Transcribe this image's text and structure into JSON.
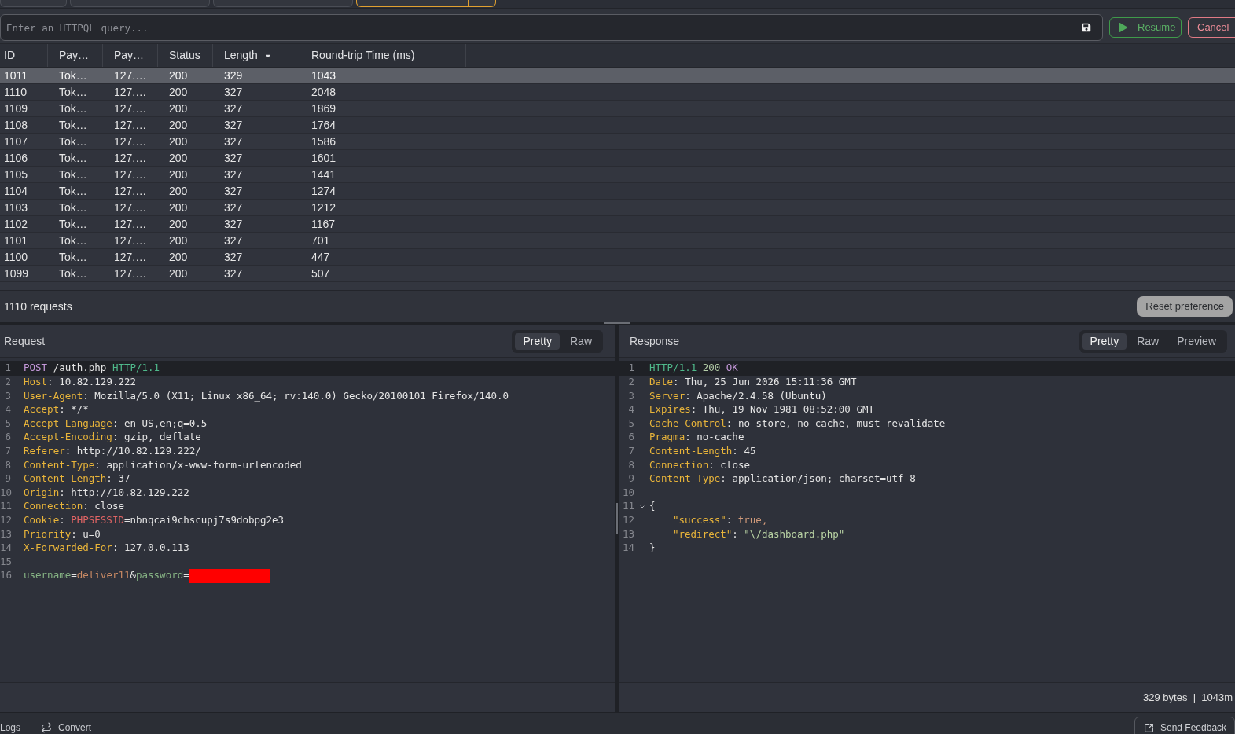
{
  "tabs": [
    {
      "selected": false
    },
    {
      "selected": false
    },
    {
      "selected": false
    },
    {
      "selected": true
    }
  ],
  "query": {
    "placeholder": "Enter an HTTPQL query..."
  },
  "buttons": [
    {
      "label": "Resume",
      "kind": "resume"
    },
    {
      "label": "Cancel",
      "kind": "cancel"
    }
  ],
  "table": {
    "columns": [
      {
        "label": "ID",
        "sorted": false
      },
      {
        "label": "Pay…",
        "sorted": false
      },
      {
        "label": "Pay…",
        "sorted": false
      },
      {
        "label": "Status",
        "sorted": false
      },
      {
        "label": "Length",
        "sorted": true
      },
      {
        "label": "Round-trip Time (ms)",
        "sorted": false
      }
    ],
    "rows": [
      {
        "cells": [
          "1011",
          "Tok…",
          "127.…",
          "200",
          "329",
          "1043"
        ],
        "selected": true
      },
      {
        "cells": [
          "1110",
          "Tok…",
          "127.…",
          "200",
          "327",
          "2048"
        ],
        "selected": false
      },
      {
        "cells": [
          "1109",
          "Tok…",
          "127.…",
          "200",
          "327",
          "1869"
        ],
        "selected": false
      },
      {
        "cells": [
          "1108",
          "Tok…",
          "127.…",
          "200",
          "327",
          "1764"
        ],
        "selected": false
      },
      {
        "cells": [
          "1107",
          "Tok…",
          "127.…",
          "200",
          "327",
          "1586"
        ],
        "selected": false
      },
      {
        "cells": [
          "1106",
          "Tok…",
          "127.…",
          "200",
          "327",
          "1601"
        ],
        "selected": false
      },
      {
        "cells": [
          "1105",
          "Tok…",
          "127.…",
          "200",
          "327",
          "1441"
        ],
        "selected": false
      },
      {
        "cells": [
          "1104",
          "Tok…",
          "127.…",
          "200",
          "327",
          "1274"
        ],
        "selected": false
      },
      {
        "cells": [
          "1103",
          "Tok…",
          "127.…",
          "200",
          "327",
          "1212"
        ],
        "selected": false
      },
      {
        "cells": [
          "1102",
          "Tok…",
          "127.…",
          "200",
          "327",
          "1167"
        ],
        "selected": false
      },
      {
        "cells": [
          "1101",
          "Tok…",
          "127.…",
          "200",
          "327",
          "701"
        ],
        "selected": false
      },
      {
        "cells": [
          "1100",
          "Tok…",
          "127.…",
          "200",
          "327",
          "447"
        ],
        "selected": false
      },
      {
        "cells": [
          "1099",
          "Tok…",
          "127.…",
          "200",
          "327",
          "507"
        ],
        "selected": false
      }
    ]
  },
  "status_bar": {
    "count": "1110 requests",
    "reset_button": "Reset preference"
  },
  "request_panel": {
    "title": "Request",
    "view_tabs": [
      {
        "label": "Pretty",
        "selected": true
      },
      {
        "label": "Raw",
        "selected": false
      }
    ],
    "lines": [
      {
        "number": "1",
        "active": true,
        "tokens": [
          {
            "text": "POST ",
            "kind": "method"
          },
          {
            "text": "/auth.php ",
            "kind": "plain"
          },
          {
            "text": "HTTP/1.1",
            "kind": "protocol"
          }
        ]
      },
      {
        "number": "2",
        "active": false,
        "tokens": [
          {
            "text": "Host",
            "kind": "header_name"
          },
          {
            "text": ": ",
            "kind": "punct"
          },
          {
            "text": "10.82.129.222",
            "kind": "value"
          }
        ]
      },
      {
        "number": "3",
        "active": false,
        "tokens": [
          {
            "text": "User-Agent",
            "kind": "header_name"
          },
          {
            "text": ": ",
            "kind": "punct"
          },
          {
            "text": "Mozilla/5.0 (X11; Linux x86_64; rv:140.0) Gecko/20100101 Firefox/140.0",
            "kind": "value"
          }
        ]
      },
      {
        "number": "4",
        "active": false,
        "tokens": [
          {
            "text": "Accept",
            "kind": "header_name"
          },
          {
            "text": ": ",
            "kind": "punct"
          },
          {
            "text": "*/*",
            "kind": "value"
          }
        ]
      },
      {
        "number": "5",
        "active": false,
        "tokens": [
          {
            "text": "Accept-Language",
            "kind": "header_name"
          },
          {
            "text": ": ",
            "kind": "punct"
          },
          {
            "text": "en-US,en;q=0.5",
            "kind": "value"
          }
        ]
      },
      {
        "number": "6",
        "active": false,
        "tokens": [
          {
            "text": "Accept-Encoding",
            "kind": "header_name"
          },
          {
            "text": ": ",
            "kind": "punct"
          },
          {
            "text": "gzip, deflate",
            "kind": "value"
          }
        ]
      },
      {
        "number": "7",
        "active": false,
        "tokens": [
          {
            "text": "Referer",
            "kind": "header_name"
          },
          {
            "text": ": ",
            "kind": "punct"
          },
          {
            "text": "http://10.82.129.222/",
            "kind": "value"
          }
        ]
      },
      {
        "number": "8",
        "active": false,
        "tokens": [
          {
            "text": "Content-Type",
            "kind": "header_name"
          },
          {
            "text": ": ",
            "kind": "punct"
          },
          {
            "text": "application/x-www-form-urlencoded",
            "kind": "value"
          }
        ]
      },
      {
        "number": "9",
        "active": false,
        "tokens": [
          {
            "text": "Content-Length",
            "kind": "header_name"
          },
          {
            "text": ": ",
            "kind": "punct"
          },
          {
            "text": "37",
            "kind": "value"
          }
        ]
      },
      {
        "number": "10",
        "active": false,
        "tokens": [
          {
            "text": "Origin",
            "kind": "header_name"
          },
          {
            "text": ": ",
            "kind": "punct"
          },
          {
            "text": "http://10.82.129.222",
            "kind": "value"
          }
        ]
      },
      {
        "number": "11",
        "active": false,
        "tokens": [
          {
            "text": "Connection",
            "kind": "header_name"
          },
          {
            "text": ": ",
            "kind": "punct"
          },
          {
            "text": "close",
            "kind": "value"
          }
        ]
      },
      {
        "number": "12",
        "active": false,
        "tokens": [
          {
            "text": "Cookie",
            "kind": "header_name"
          },
          {
            "text": ": ",
            "kind": "punct"
          },
          {
            "text": "PHPSESSID",
            "kind": "cookie_name"
          },
          {
            "text": "=nbnqcai9chscupj7s9dobpg2e3",
            "kind": "value"
          }
        ]
      },
      {
        "number": "13",
        "active": false,
        "tokens": [
          {
            "text": "Priority",
            "kind": "header_name"
          },
          {
            "text": ": ",
            "kind": "punct"
          },
          {
            "text": "u=0",
            "kind": "value"
          }
        ]
      },
      {
        "number": "14",
        "active": false,
        "tokens": [
          {
            "text": "X-Forwarded-For",
            "kind": "header_name"
          },
          {
            "text": ": ",
            "kind": "punct"
          },
          {
            "text": "127.0.0.113",
            "kind": "value"
          }
        ]
      },
      {
        "number": "15",
        "active": false
      },
      {
        "number": "16",
        "active": false,
        "tokens": [
          {
            "text": "username",
            "kind": "param_name"
          },
          {
            "text": "=",
            "kind": "punct"
          },
          {
            "text": "deliver11",
            "kind": "param_value"
          },
          {
            "text": "&",
            "kind": "punct"
          },
          {
            "text": "password",
            "kind": "param_name"
          },
          {
            "text": "=",
            "kind": "punct"
          },
          {
            "kind": "redacted"
          }
        ]
      }
    ]
  },
  "response_panel": {
    "title": "Response",
    "view_tabs": [
      {
        "label": "Pretty",
        "selected": true
      },
      {
        "label": "Raw",
        "selected": false
      },
      {
        "label": "Preview",
        "selected": false
      }
    ],
    "lines": [
      {
        "number": "1",
        "active": true,
        "tokens": [
          {
            "text": "HTTP/1.1 ",
            "kind": "protocol"
          },
          {
            "text": "200 ",
            "kind": "status_code"
          },
          {
            "text": "OK",
            "kind": "status_text"
          }
        ]
      },
      {
        "number": "2",
        "active": false,
        "tokens": [
          {
            "text": "Date",
            "kind": "header_name"
          },
          {
            "text": ": ",
            "kind": "punct"
          },
          {
            "text": "Thu, 25 Jun 2026 15:11:36 GMT",
            "kind": "value"
          }
        ]
      },
      {
        "number": "3",
        "active": false,
        "tokens": [
          {
            "text": "Server",
            "kind": "header_name"
          },
          {
            "text": ": ",
            "kind": "punct"
          },
          {
            "text": "Apache/2.4.58 (Ubuntu)",
            "kind": "value"
          }
        ]
      },
      {
        "number": "4",
        "active": false,
        "tokens": [
          {
            "text": "Expires",
            "kind": "header_name"
          },
          {
            "text": ": ",
            "kind": "punct"
          },
          {
            "text": "Thu, 19 Nov 1981 08:52:00 GMT",
            "kind": "value"
          }
        ]
      },
      {
        "number": "5",
        "active": false,
        "tokens": [
          {
            "text": "Cache-Control",
            "kind": "header_name"
          },
          {
            "text": ": ",
            "kind": "punct"
          },
          {
            "text": "no-store, no-cache, must-revalidate",
            "kind": "value"
          }
        ]
      },
      {
        "number": "6",
        "active": false,
        "tokens": [
          {
            "text": "Pragma",
            "kind": "header_name"
          },
          {
            "text": ": ",
            "kind": "punct"
          },
          {
            "text": "no-cache",
            "kind": "value"
          }
        ]
      },
      {
        "number": "7",
        "active": false,
        "tokens": [
          {
            "text": "Content-Length",
            "kind": "header_name"
          },
          {
            "text": ": ",
            "kind": "punct"
          },
          {
            "text": "45",
            "kind": "value"
          }
        ]
      },
      {
        "number": "8",
        "active": false,
        "tokens": [
          {
            "text": "Connection",
            "kind": "header_name"
          },
          {
            "text": ": ",
            "kind": "punct"
          },
          {
            "text": "close",
            "kind": "value"
          }
        ]
      },
      {
        "number": "9",
        "active": false,
        "tokens": [
          {
            "text": "Content-Type",
            "kind": "header_name"
          },
          {
            "text": ": ",
            "kind": "punct"
          },
          {
            "text": "application/json; charset=utf-8",
            "kind": "value"
          }
        ]
      },
      {
        "number": "10",
        "active": false
      },
      {
        "number": "11",
        "active": false,
        "expanded": true,
        "tokens": [
          {
            "text": "{",
            "kind": "brace"
          }
        ],
        "children": [
          {
            "number": "12",
            "active": false,
            "tokens": [
              {
                "text": "\"success\"",
                "kind": "json_key"
              },
              {
                "text": ": ",
                "kind": "punct"
              },
              {
                "text": "true",
                "kind": "json_bool"
              },
              {
                "text": ",",
                "kind": "json_bool"
              }
            ]
          },
          {
            "number": "13",
            "active": false,
            "tokens": [
              {
                "text": "\"redirect\"",
                "kind": "json_key"
              },
              {
                "text": ": ",
                "kind": "punct"
              },
              {
                "text": "\"\\/dashboard.php\"",
                "kind": "json_string"
              }
            ]
          }
        ]
      },
      {
        "number": "14",
        "active": false,
        "tokens": [
          {
            "text": "}",
            "kind": "brace"
          }
        ]
      }
    ],
    "footer": "329 bytes  |  1043m"
  },
  "bottom_bar": {
    "items": [
      {
        "label": "Logs",
        "kind": "plain"
      },
      {
        "label": "Convert",
        "kind": "convert"
      }
    ],
    "feedback_button": "Send Feedback"
  }
}
